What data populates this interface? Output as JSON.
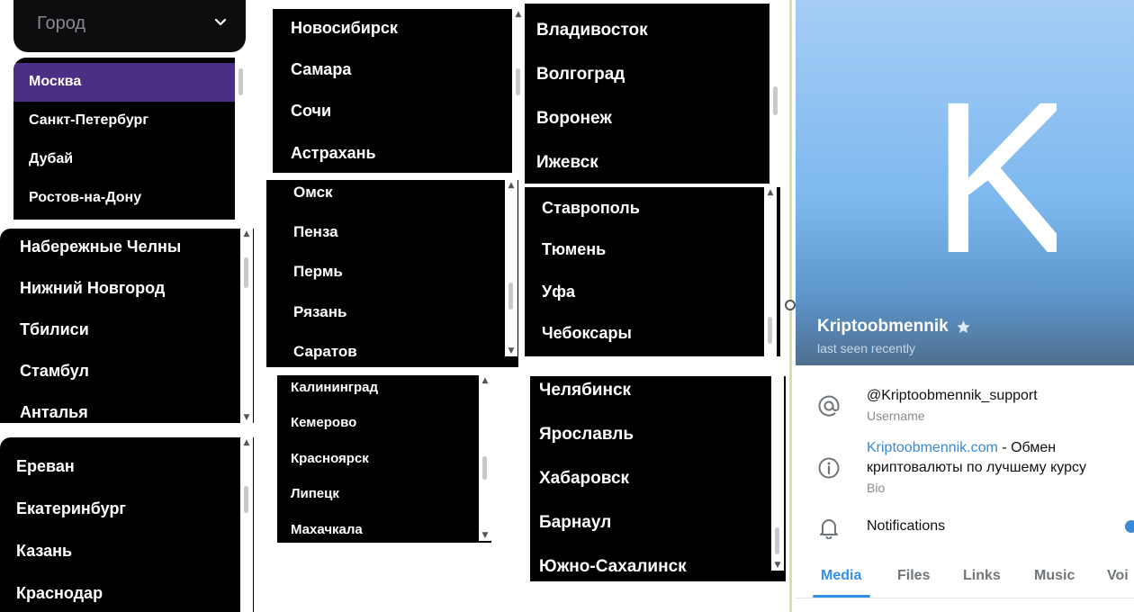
{
  "dropdown": {
    "placeholder": "Город",
    "options": [
      "Москва",
      "Санкт-Петербург",
      "Дубай",
      "Ростов-на-Дону"
    ],
    "selected": "Москва",
    "accent": "#4b2f86"
  },
  "lists": {
    "l_left_mid": [
      "Набережные Челны",
      "Нижний Новгород",
      "Тбилиси",
      "Стамбул",
      "Анталья"
    ],
    "l_left_bot": [
      "Ереван",
      "Екатеринбург",
      "Казань",
      "Краснодар"
    ],
    "l_mid_top": [
      "Новосибирск",
      "Самара",
      "Сочи",
      "Астрахань"
    ],
    "l_mid_mid": [
      "Омск",
      "Пенза",
      "Пермь",
      "Рязань",
      "Саратов"
    ],
    "l_mid_bot": [
      "Калининград",
      "Кемерово",
      "Красноярск",
      "Липецк",
      "Махачкала"
    ],
    "l_right_top": [
      "Владивосток",
      "Волгоград",
      "Воронеж",
      "Ижевск"
    ],
    "l_right_mid": [
      "Ставрополь",
      "Тюмень",
      "Уфа",
      "Чебоксары"
    ],
    "l_right_bot": [
      "Челябинск",
      "Ярославль",
      "Хабаровск",
      "Барнаул",
      "Южно-Сахалинск"
    ]
  },
  "profile": {
    "avatar_letter": "K",
    "name": "Kriptoobmennik",
    "status": "last seen recently",
    "username": "@Kriptoobmennik_support",
    "username_label": "Username",
    "bio_link": "Kriptoobmennik.com",
    "bio_text_1": " - Обмен",
    "bio_text_2": "криптовалюты по лучшему курсу",
    "bio_label": "Bio",
    "notifications": "Notifications",
    "tabs": [
      "Media",
      "Files",
      "Links",
      "Music",
      "Voi"
    ],
    "active_tab": "Media",
    "accent": "#3390ec"
  },
  "icons": [
    "chevron-down-icon",
    "at-icon",
    "info-icon",
    "bell-icon",
    "star-icon",
    "scroll-up-arrow-icon",
    "scroll-down-arrow-icon"
  ]
}
